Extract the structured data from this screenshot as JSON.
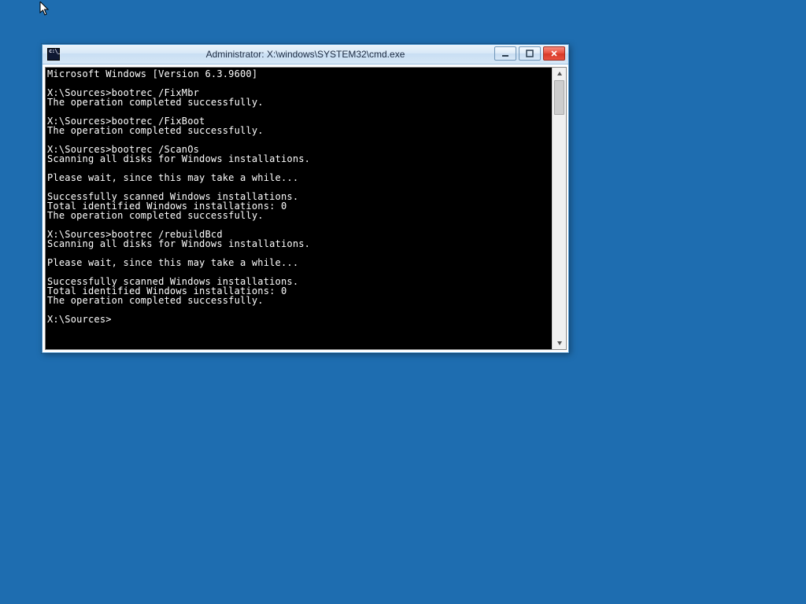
{
  "window": {
    "title": "Administrator: X:\\windows\\SYSTEM32\\cmd.exe"
  },
  "console": {
    "lines": [
      "Microsoft Windows [Version 6.3.9600]",
      "",
      "X:\\Sources>bootrec /FixMbr",
      "The operation completed successfully.",
      "",
      "X:\\Sources>bootrec /FixBoot",
      "The operation completed successfully.",
      "",
      "X:\\Sources>bootrec /ScanOs",
      "Scanning all disks for Windows installations.",
      "",
      "Please wait, since this may take a while...",
      "",
      "Successfully scanned Windows installations.",
      "Total identified Windows installations: 0",
      "The operation completed successfully.",
      "",
      "X:\\Sources>bootrec /rebuildBcd",
      "Scanning all disks for Windows installations.",
      "",
      "Please wait, since this may take a while...",
      "",
      "Successfully scanned Windows installations.",
      "Total identified Windows installations: 0",
      "The operation completed successfully.",
      "",
      "X:\\Sources>"
    ]
  }
}
